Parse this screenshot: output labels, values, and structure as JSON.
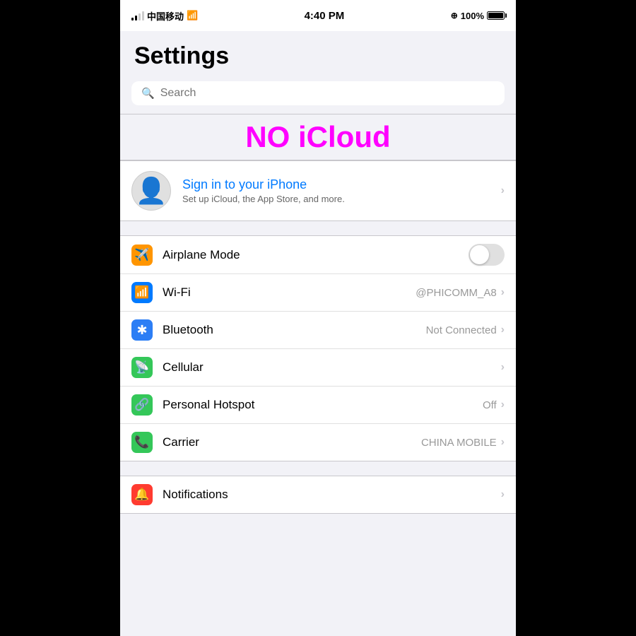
{
  "statusBar": {
    "carrier": "中国移动",
    "time": "4:40 PM",
    "locationIcon": "⊕",
    "battery": "100%"
  },
  "title": "Settings",
  "search": {
    "placeholder": "Search"
  },
  "noICloud": {
    "text": "NO iCloud"
  },
  "signIn": {
    "primary": "Sign in to your iPhone",
    "secondary": "Set up iCloud, the App Store, and more."
  },
  "networkGroup": [
    {
      "id": "airplane",
      "label": "Airplane Mode",
      "value": "",
      "hasToggle": true,
      "hasChevron": false
    },
    {
      "id": "wifi",
      "label": "Wi-Fi",
      "value": "@PHICOMM_A8",
      "hasToggle": false,
      "hasChevron": true
    },
    {
      "id": "bluetooth",
      "label": "Bluetooth",
      "value": "Not Connected",
      "hasToggle": false,
      "hasChevron": true
    },
    {
      "id": "cellular",
      "label": "Cellular",
      "value": "",
      "hasToggle": false,
      "hasChevron": true
    },
    {
      "id": "hotspot",
      "label": "Personal Hotspot",
      "value": "Off",
      "hasToggle": false,
      "hasChevron": true
    },
    {
      "id": "carrier",
      "label": "Carrier",
      "value": "CHINA MOBILE",
      "hasToggle": false,
      "hasChevron": true
    }
  ],
  "notificationsGroup": [
    {
      "id": "notifications",
      "label": "Notifications",
      "value": "",
      "hasToggle": false,
      "hasChevron": true
    }
  ]
}
